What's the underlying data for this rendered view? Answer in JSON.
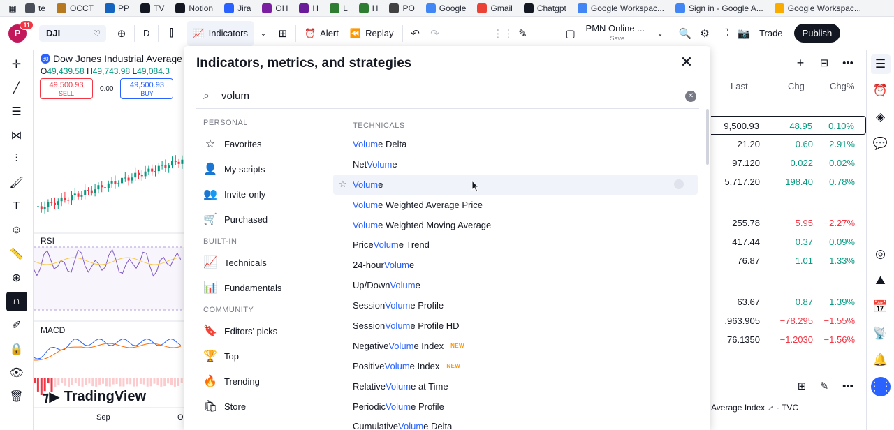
{
  "bookmarks": [
    {
      "label": "te",
      "color": "#4a4e59",
      "icon": "leaf-icon"
    },
    {
      "label": "OCCT",
      "color": "#b7791f",
      "icon": "box-icon"
    },
    {
      "label": "PP",
      "color": "#1565c0",
      "icon": "p-icon"
    },
    {
      "label": "TV",
      "color": "#131722",
      "icon": "tv-icon"
    },
    {
      "label": "Notion",
      "color": "#131722",
      "icon": "home-icon"
    },
    {
      "label": "Jira",
      "color": "#2962ff",
      "icon": "jira-icon"
    },
    {
      "label": "OH",
      "color": "#7b1fa2",
      "icon": "circle-icon"
    },
    {
      "label": "H",
      "color": "#6a1b9a",
      "icon": "s-icon"
    },
    {
      "label": "L",
      "color": "#2e7d32",
      "icon": "sheet-icon"
    },
    {
      "label": "H",
      "color": "#2e7d32",
      "icon": "sheet-icon"
    },
    {
      "label": "PO",
      "color": "#424242",
      "icon": "globe-icon"
    },
    {
      "label": "Google",
      "color": "#4285f4",
      "icon": "google-icon"
    },
    {
      "label": "Gmail",
      "color": "#ea4335",
      "icon": "gmail-icon"
    },
    {
      "label": "Chatgpt",
      "color": "#131722",
      "icon": "openai-icon"
    },
    {
      "label": "Google Workspac...",
      "color": "#4285f4",
      "icon": "google-icon"
    },
    {
      "label": "Sign in - Google A...",
      "color": "#4285f4",
      "icon": "google-icon"
    },
    {
      "label": "Google Workspac...",
      "color": "#f9ab00",
      "icon": "workspace-icon"
    }
  ],
  "toolbar": {
    "avatar_letter": "P",
    "notif_count": "11",
    "symbol": "DJI",
    "interval": "D",
    "indicators_label": "Indicators",
    "alert_label": "Alert",
    "replay_label": "Replay",
    "layout_name": "PMN Online ...",
    "layout_sub": "Save",
    "trade_label": "Trade",
    "publish_label": "Publish"
  },
  "chart": {
    "title": "Dow Jones Industrial Average",
    "ohlc_o_label": "O",
    "ohlc_o": "49,439.58",
    "ohlc_h_label": "H",
    "ohlc_h": "49,743.98",
    "ohlc_l_label": "L",
    "ohlc_l": "49,084.3",
    "sell_price": "49,500.93",
    "sell_label": "SELL",
    "spread": "0.00",
    "buy_price": "49,500.93",
    "buy_label": "BUY",
    "rsi_label": "RSI",
    "macd_label": "MACD",
    "brand": "TradingView",
    "x_label_1": "Sep",
    "x_label_2": "O"
  },
  "watchlist": {
    "col_last": "Last",
    "col_chg": "Chg",
    "col_pct": "Chg%",
    "rows": [
      {
        "last": "9,500.93",
        "chg": "48.95",
        "pct": "0.10%",
        "dir": "pos",
        "selected": true
      },
      {
        "last": "21.20",
        "chg": "0.60",
        "pct": "2.91%",
        "dir": "pos"
      },
      {
        "last": "97.120",
        "chg": "0.022",
        "pct": "0.02%",
        "dir": "pos"
      },
      {
        "last": "5,717.20",
        "chg": "198.40",
        "pct": "0.78%",
        "dir": "pos"
      },
      {
        "last": "255.78",
        "chg": "−5.95",
        "pct": "−2.27%",
        "dir": "neg"
      },
      {
        "last": "417.44",
        "chg": "0.37",
        "pct": "0.09%",
        "dir": "pos"
      },
      {
        "last": "76.87",
        "chg": "1.01",
        "pct": "1.33%",
        "dir": "pos"
      },
      {
        "last": "63.67",
        "chg": "0.87",
        "pct": "1.39%",
        "dir": "pos"
      },
      {
        "last": ",963.905",
        "chg": "−78.295",
        "pct": "−1.55%",
        "dir": "neg"
      },
      {
        "last": "76.1350",
        "chg": "−1.2030",
        "pct": "−1.56%",
        "dir": "neg"
      }
    ],
    "bottom_text": "Average Index",
    "bottom_source": "TVC"
  },
  "dialog": {
    "title": "Indicators, metrics, and strategies",
    "search_value": "volum",
    "sections": [
      {
        "head": "PERSONAL",
        "items": [
          {
            "label": "Favorites",
            "icon": "star-icon"
          },
          {
            "label": "My scripts",
            "icon": "user-icon"
          },
          {
            "label": "Invite-only",
            "icon": "users-icon"
          },
          {
            "label": "Purchased",
            "icon": "cart-icon"
          }
        ]
      },
      {
        "head": "BUILT-IN",
        "items": [
          {
            "label": "Technicals",
            "icon": "chart-line-icon"
          },
          {
            "label": "Fundamentals",
            "icon": "bar-chart-icon"
          }
        ]
      },
      {
        "head": "COMMUNITY",
        "items": [
          {
            "label": "Editors' picks",
            "icon": "bookmark-icon"
          },
          {
            "label": "Top",
            "icon": "trophy-icon"
          },
          {
            "label": "Trending",
            "icon": "flame-icon"
          },
          {
            "label": "Store",
            "icon": "store-icon"
          }
        ]
      }
    ],
    "results_head": "TECHNICALS",
    "results": [
      {
        "pre": "",
        "hl": "Volum",
        "suf": "e Delta"
      },
      {
        "pre": "Net ",
        "hl": "Volum",
        "suf": "e"
      },
      {
        "pre": "",
        "hl": "Volum",
        "suf": "e",
        "hover": true
      },
      {
        "pre": "",
        "hl": "Volum",
        "suf": "e Weighted Average Price"
      },
      {
        "pre": "",
        "hl": "Volum",
        "suf": "e Weighted Moving Average"
      },
      {
        "pre": "Price ",
        "hl": "Volum",
        "suf": "e Trend"
      },
      {
        "pre": "24-hour ",
        "hl": "Volum",
        "suf": "e"
      },
      {
        "pre": "Up/Down ",
        "hl": "Volum",
        "suf": "e"
      },
      {
        "pre": "Session ",
        "hl": "Volum",
        "suf": "e Profile"
      },
      {
        "pre": "Session ",
        "hl": "Volum",
        "suf": "e Profile HD"
      },
      {
        "pre": "Negative ",
        "hl": "Volum",
        "suf": "e Index",
        "badge": "NEW"
      },
      {
        "pre": "Positive ",
        "hl": "Volum",
        "suf": "e Index",
        "badge": "NEW"
      },
      {
        "pre": "Relative ",
        "hl": "Volum",
        "suf": "e at Time"
      },
      {
        "pre": "Periodic ",
        "hl": "Volum",
        "suf": "e Profile"
      },
      {
        "pre": "Cumulative ",
        "hl": "Volum",
        "suf": "e Delta"
      }
    ]
  }
}
